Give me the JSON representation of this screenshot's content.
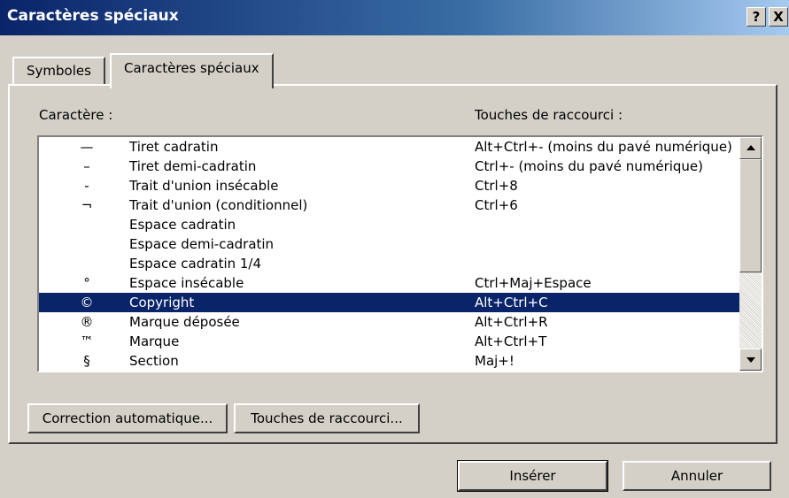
{
  "window": {
    "title": "Caractères spéciaux",
    "help_label": "?",
    "close_label": "X"
  },
  "tabs": [
    {
      "label": "Symboles",
      "active": false
    },
    {
      "label": "Caractères spéciaux",
      "active": true
    }
  ],
  "list": {
    "header_character": "Caractère :",
    "header_shortcut": "Touches de raccourci :",
    "selected_index": 8,
    "rows": [
      {
        "symbol": "—",
        "name": "Tiret cadratin",
        "shortcut": "Alt+Ctrl+- (moins du pavé numérique)"
      },
      {
        "symbol": "–",
        "name": "Tiret demi-cadratin",
        "shortcut": "Ctrl+- (moins du pavé numérique)"
      },
      {
        "symbol": "-",
        "name": "Trait d'union insécable",
        "shortcut": "Ctrl+8"
      },
      {
        "symbol": "¬",
        "name": "Trait d'union (conditionnel)",
        "shortcut": "Ctrl+6"
      },
      {
        "symbol": "",
        "name": "Espace cadratin",
        "shortcut": ""
      },
      {
        "symbol": "",
        "name": "Espace demi-cadratin",
        "shortcut": ""
      },
      {
        "symbol": "",
        "name": "Espace cadratin 1/4",
        "shortcut": ""
      },
      {
        "symbol": "°",
        "name": "Espace insécable",
        "shortcut": "Ctrl+Maj+Espace"
      },
      {
        "symbol": "©",
        "name": "Copyright",
        "shortcut": "Alt+Ctrl+C"
      },
      {
        "symbol": "®",
        "name": "Marque déposée",
        "shortcut": "Alt+Ctrl+R"
      },
      {
        "symbol": "™",
        "name": "Marque",
        "shortcut": "Alt+Ctrl+T"
      },
      {
        "symbol": "§",
        "name": "Section",
        "shortcut": "Maj+!"
      }
    ]
  },
  "buttons": {
    "autocorrect": "Correction automatique...",
    "shortcut_keys": "Touches de raccourci...",
    "insert": "Insérer",
    "cancel": "Annuler"
  },
  "colors": {
    "titlebar_start": "#0a246a",
    "titlebar_end": "#a6caf0",
    "selection": "#0a246a",
    "dialog_face": "#d4d0c8"
  }
}
